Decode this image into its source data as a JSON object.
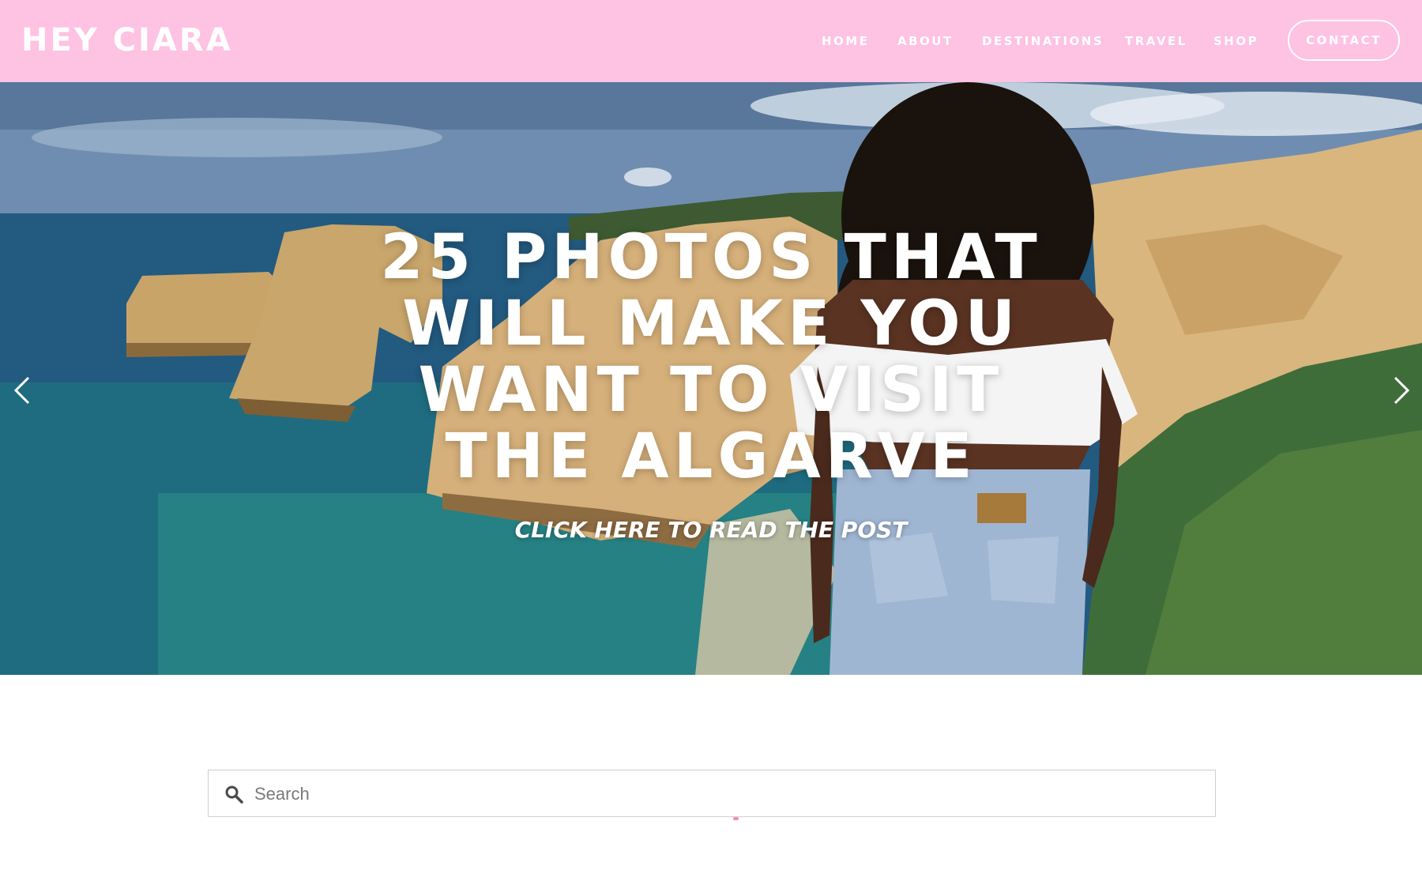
{
  "header": {
    "logo": "HEY CIARA",
    "background": "#fec2e3",
    "nav": [
      {
        "label": "HOME"
      },
      {
        "label": "ABOUT"
      },
      {
        "label": "DESTINATIONS"
      },
      {
        "label": "TRAVEL"
      },
      {
        "label": "SHOP"
      }
    ],
    "contact_label": "CONTACT"
  },
  "hero": {
    "title": "25 PHOTOS THAT WILL MAKE YOU WANT TO VISIT THE ALGARVE",
    "cta": "CLICK HERE TO READ THE POST",
    "prev_icon": "chevron-left-icon",
    "next_icon": "chevron-right-icon"
  },
  "search": {
    "placeholder": "Search",
    "value": "",
    "icon": "search-icon"
  }
}
